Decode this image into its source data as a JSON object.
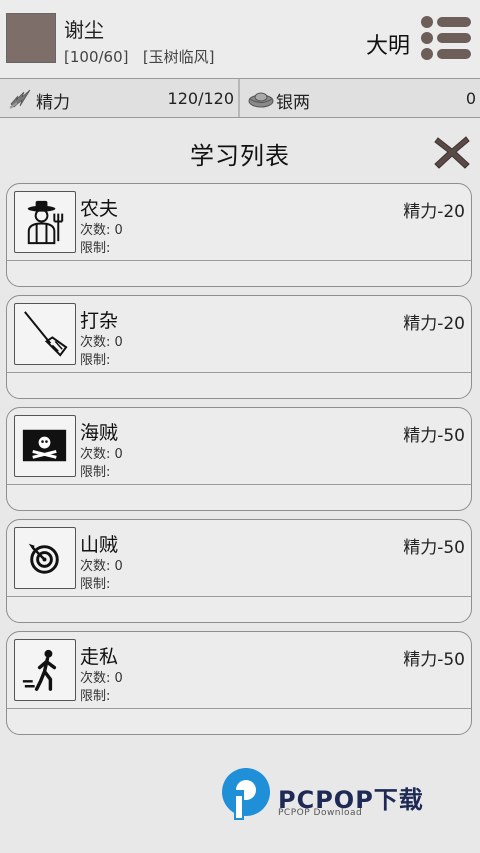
{
  "header": {
    "player_name": "谢尘",
    "player_level": "[100/60]",
    "player_title": "[玉树临风]",
    "dynasty": "大明"
  },
  "stats": {
    "energy_label": "精力",
    "energy_value": "120/120",
    "silver_label": "银两",
    "silver_value": "0"
  },
  "panel": {
    "title": "学习列表"
  },
  "jobs": [
    {
      "name": "农夫",
      "cost": "精力-20",
      "count": "次数: 0",
      "limit": "限制:",
      "icon": "farmer-icon"
    },
    {
      "name": "打杂",
      "cost": "精力-20",
      "count": "次数: 0",
      "limit": "限制:",
      "icon": "broom-icon"
    },
    {
      "name": "海贼",
      "cost": "精力-50",
      "count": "次数: 0",
      "limit": "限制:",
      "icon": "pirate-flag-icon"
    },
    {
      "name": "山贼",
      "cost": "精力-50",
      "count": "次数: 0",
      "limit": "限制:",
      "icon": "target-icon"
    },
    {
      "name": "走私",
      "cost": "精力-50",
      "count": "次数: 0",
      "limit": "限制:",
      "icon": "walking-man-icon"
    }
  ],
  "watermark": {
    "brand": "PCPOP下载",
    "sub": "PCPOP Download"
  },
  "colors": {
    "background": "#e8e8e8",
    "avatar": "#7e6e6a",
    "menu_icon": "#6e5e5a",
    "watermark_blue": "#1f8fd8"
  }
}
